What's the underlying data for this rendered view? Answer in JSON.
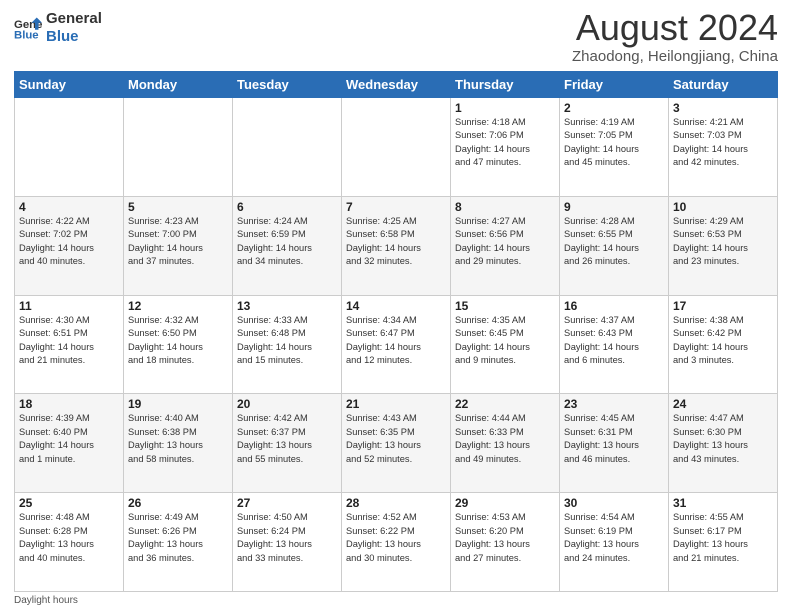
{
  "logo": {
    "text_general": "General",
    "text_blue": "Blue"
  },
  "header": {
    "month_title": "August 2024",
    "subtitle": "Zhaodong, Heilongjiang, China"
  },
  "days_of_week": [
    "Sunday",
    "Monday",
    "Tuesday",
    "Wednesday",
    "Thursday",
    "Friday",
    "Saturday"
  ],
  "weeks": [
    [
      {
        "day": "",
        "info": ""
      },
      {
        "day": "",
        "info": ""
      },
      {
        "day": "",
        "info": ""
      },
      {
        "day": "",
        "info": ""
      },
      {
        "day": "1",
        "info": "Sunrise: 4:18 AM\nSunset: 7:06 PM\nDaylight: 14 hours\nand 47 minutes."
      },
      {
        "day": "2",
        "info": "Sunrise: 4:19 AM\nSunset: 7:05 PM\nDaylight: 14 hours\nand 45 minutes."
      },
      {
        "day": "3",
        "info": "Sunrise: 4:21 AM\nSunset: 7:03 PM\nDaylight: 14 hours\nand 42 minutes."
      }
    ],
    [
      {
        "day": "4",
        "info": "Sunrise: 4:22 AM\nSunset: 7:02 PM\nDaylight: 14 hours\nand 40 minutes."
      },
      {
        "day": "5",
        "info": "Sunrise: 4:23 AM\nSunset: 7:00 PM\nDaylight: 14 hours\nand 37 minutes."
      },
      {
        "day": "6",
        "info": "Sunrise: 4:24 AM\nSunset: 6:59 PM\nDaylight: 14 hours\nand 34 minutes."
      },
      {
        "day": "7",
        "info": "Sunrise: 4:25 AM\nSunset: 6:58 PM\nDaylight: 14 hours\nand 32 minutes."
      },
      {
        "day": "8",
        "info": "Sunrise: 4:27 AM\nSunset: 6:56 PM\nDaylight: 14 hours\nand 29 minutes."
      },
      {
        "day": "9",
        "info": "Sunrise: 4:28 AM\nSunset: 6:55 PM\nDaylight: 14 hours\nand 26 minutes."
      },
      {
        "day": "10",
        "info": "Sunrise: 4:29 AM\nSunset: 6:53 PM\nDaylight: 14 hours\nand 23 minutes."
      }
    ],
    [
      {
        "day": "11",
        "info": "Sunrise: 4:30 AM\nSunset: 6:51 PM\nDaylight: 14 hours\nand 21 minutes."
      },
      {
        "day": "12",
        "info": "Sunrise: 4:32 AM\nSunset: 6:50 PM\nDaylight: 14 hours\nand 18 minutes."
      },
      {
        "day": "13",
        "info": "Sunrise: 4:33 AM\nSunset: 6:48 PM\nDaylight: 14 hours\nand 15 minutes."
      },
      {
        "day": "14",
        "info": "Sunrise: 4:34 AM\nSunset: 6:47 PM\nDaylight: 14 hours\nand 12 minutes."
      },
      {
        "day": "15",
        "info": "Sunrise: 4:35 AM\nSunset: 6:45 PM\nDaylight: 14 hours\nand 9 minutes."
      },
      {
        "day": "16",
        "info": "Sunrise: 4:37 AM\nSunset: 6:43 PM\nDaylight: 14 hours\nand 6 minutes."
      },
      {
        "day": "17",
        "info": "Sunrise: 4:38 AM\nSunset: 6:42 PM\nDaylight: 14 hours\nand 3 minutes."
      }
    ],
    [
      {
        "day": "18",
        "info": "Sunrise: 4:39 AM\nSunset: 6:40 PM\nDaylight: 14 hours\nand 1 minute."
      },
      {
        "day": "19",
        "info": "Sunrise: 4:40 AM\nSunset: 6:38 PM\nDaylight: 13 hours\nand 58 minutes."
      },
      {
        "day": "20",
        "info": "Sunrise: 4:42 AM\nSunset: 6:37 PM\nDaylight: 13 hours\nand 55 minutes."
      },
      {
        "day": "21",
        "info": "Sunrise: 4:43 AM\nSunset: 6:35 PM\nDaylight: 13 hours\nand 52 minutes."
      },
      {
        "day": "22",
        "info": "Sunrise: 4:44 AM\nSunset: 6:33 PM\nDaylight: 13 hours\nand 49 minutes."
      },
      {
        "day": "23",
        "info": "Sunrise: 4:45 AM\nSunset: 6:31 PM\nDaylight: 13 hours\nand 46 minutes."
      },
      {
        "day": "24",
        "info": "Sunrise: 4:47 AM\nSunset: 6:30 PM\nDaylight: 13 hours\nand 43 minutes."
      }
    ],
    [
      {
        "day": "25",
        "info": "Sunrise: 4:48 AM\nSunset: 6:28 PM\nDaylight: 13 hours\nand 40 minutes."
      },
      {
        "day": "26",
        "info": "Sunrise: 4:49 AM\nSunset: 6:26 PM\nDaylight: 13 hours\nand 36 minutes."
      },
      {
        "day": "27",
        "info": "Sunrise: 4:50 AM\nSunset: 6:24 PM\nDaylight: 13 hours\nand 33 minutes."
      },
      {
        "day": "28",
        "info": "Sunrise: 4:52 AM\nSunset: 6:22 PM\nDaylight: 13 hours\nand 30 minutes."
      },
      {
        "day": "29",
        "info": "Sunrise: 4:53 AM\nSunset: 6:20 PM\nDaylight: 13 hours\nand 27 minutes."
      },
      {
        "day": "30",
        "info": "Sunrise: 4:54 AM\nSunset: 6:19 PM\nDaylight: 13 hours\nand 24 minutes."
      },
      {
        "day": "31",
        "info": "Sunrise: 4:55 AM\nSunset: 6:17 PM\nDaylight: 13 hours\nand 21 minutes."
      }
    ]
  ],
  "footer": {
    "note": "Daylight hours"
  }
}
